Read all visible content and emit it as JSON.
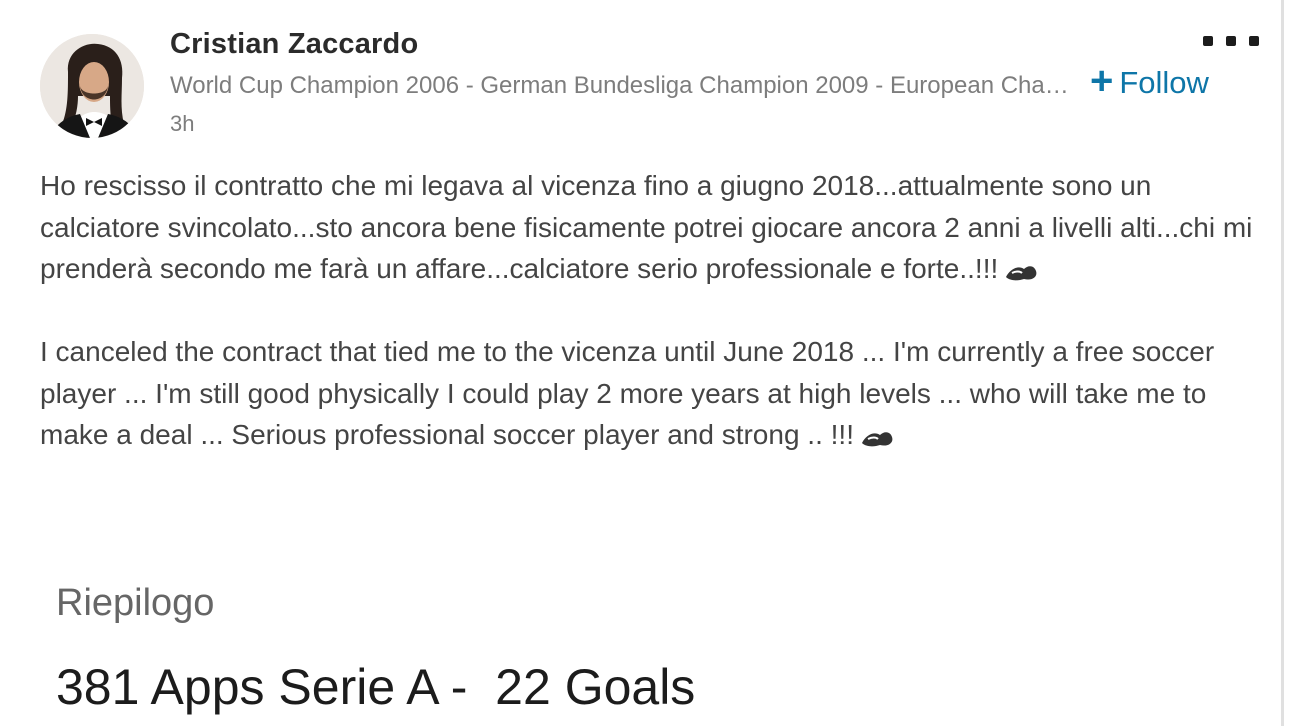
{
  "post": {
    "author": {
      "name": "Cristian Zaccardo",
      "headline": "World Cup Champion 2006 - German Bundesliga Champion 2009 - European Champion",
      "time": "3h",
      "avatar_icon": "profile-photo-icon"
    },
    "actions": {
      "follow_plus": "+",
      "follow_label": "Follow",
      "more_icon": "more-options-icon"
    },
    "body": {
      "italian_text": "Ho rescisso il contratto che mi legava al vicenza fino a giugno 2018...attualmente sono un calciatore svincolato...sto ancora bene fisicamente potrei giocare ancora 2 anni a livelli alti...chi mi prenderà secondo me farà un affare...calciatore serio professionale e forte..!!!",
      "english_text": "I canceled the contract that tied me to the vicenza until June 2018 ... I'm currently a free soccer player ... I'm still good physically I could play 2 more years at high levels ... who will take me to make a deal ... Serious professional soccer player and strong .. !!!",
      "emoji_icon": "flexed-biceps-icon"
    }
  },
  "summary": {
    "title": "Riepilogo",
    "stats": "381 Apps Serie A -  22 Goals"
  },
  "colors": {
    "accent": "#0e76a8",
    "text": "#444444",
    "muted": "#7d7d7d"
  }
}
